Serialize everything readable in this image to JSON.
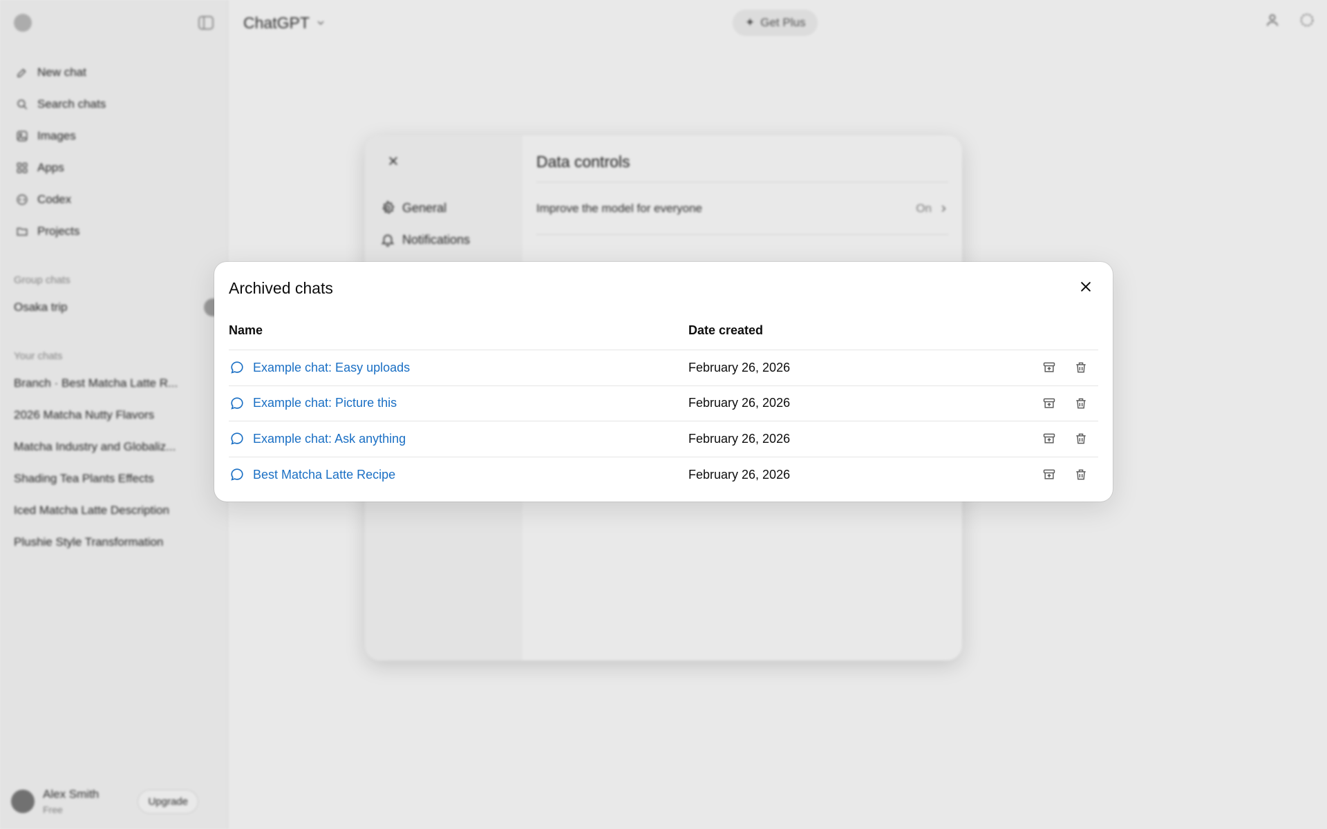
{
  "app": {
    "model_name": "ChatGPT",
    "get_plus_label": "Get Plus"
  },
  "sidebar": {
    "nav": [
      {
        "label": "New chat",
        "icon": "edit-icon"
      },
      {
        "label": "Search chats",
        "icon": "search-icon"
      },
      {
        "label": "Images",
        "icon": "images-icon"
      },
      {
        "label": "Apps",
        "icon": "apps-icon"
      },
      {
        "label": "Codex",
        "icon": "codex-icon"
      },
      {
        "label": "Projects",
        "icon": "folder-icon"
      }
    ],
    "group_chats_heading": "Group chats",
    "group_chats": [
      "Osaka trip"
    ],
    "your_chats_heading": "Your chats",
    "chats": [
      "Branch · Best Matcha Latte R...",
      "2026 Matcha Nutty Flavors",
      "Matcha Industry and Globaliz...",
      "Shading Tea Plants Effects",
      "Iced Matcha Latte Description",
      "Plushie Style Transformation"
    ],
    "user": {
      "name": "Alex Smith",
      "plan": "Free",
      "upgrade_label": "Upgrade"
    }
  },
  "settings": {
    "nav": [
      {
        "label": "General",
        "icon": "gear-icon"
      },
      {
        "label": "Notifications",
        "icon": "bell-icon"
      }
    ],
    "title": "Data controls",
    "rows": [
      {
        "label": "Improve the model for everyone",
        "value": "On"
      }
    ]
  },
  "archived_modal": {
    "title": "Archived chats",
    "columns": {
      "name": "Name",
      "date": "Date created"
    },
    "rows": [
      {
        "name": "Example chat: Easy uploads",
        "date": "February 26, 2026"
      },
      {
        "name": "Example chat: Picture this",
        "date": "February 26, 2026"
      },
      {
        "name": "Example chat: Ask anything",
        "date": "February 26, 2026"
      },
      {
        "name": "Best Matcha Latte Recipe",
        "date": "February 26, 2026"
      }
    ]
  },
  "colors": {
    "link": "#1a6fc4",
    "overlay": "rgba(0,0,0,0.085)"
  }
}
